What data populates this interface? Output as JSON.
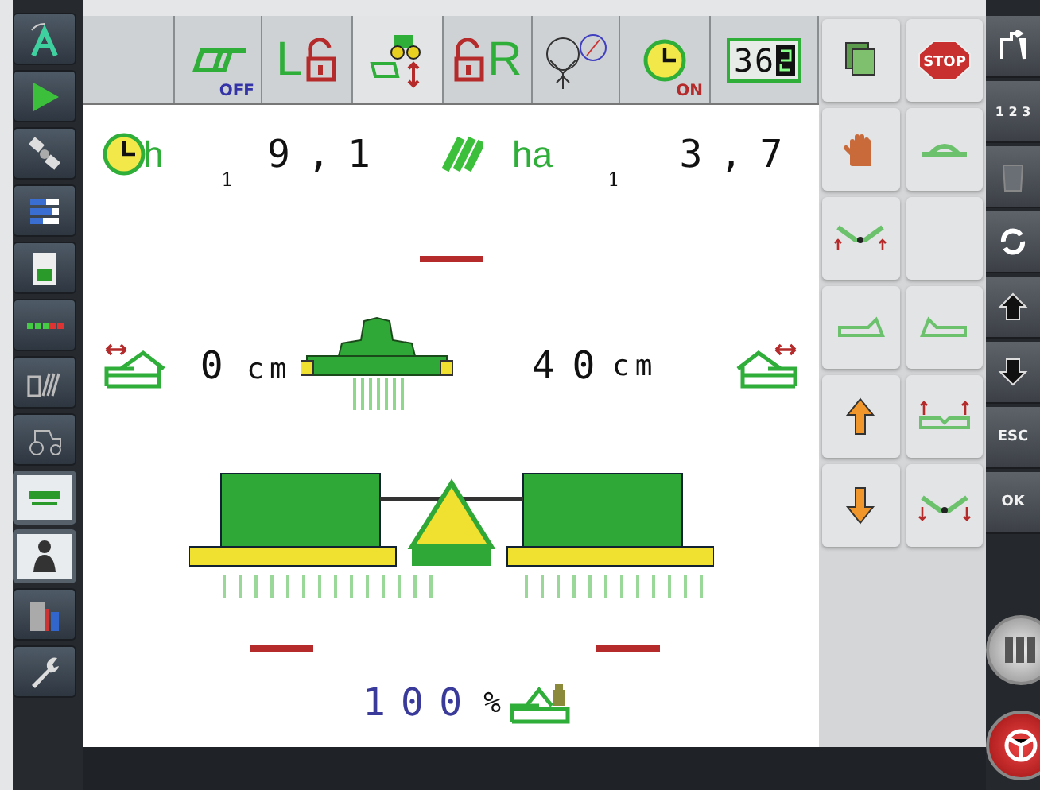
{
  "sidebar": {
    "items": [
      {
        "kind": "navigation"
      },
      {
        "kind": "play"
      },
      {
        "kind": "satellite"
      },
      {
        "kind": "bars"
      },
      {
        "kind": "document"
      },
      {
        "kind": "sections"
      },
      {
        "kind": "area"
      },
      {
        "kind": "tractor"
      },
      {
        "kind": "implement"
      },
      {
        "kind": "operator"
      },
      {
        "kind": "bins"
      },
      {
        "kind": "wrench"
      }
    ]
  },
  "toolbar": {
    "cells": [
      {
        "kind": "blank"
      },
      {
        "kind": "section_control",
        "status": "OFF"
      },
      {
        "kind": "lock_left",
        "label": "L"
      },
      {
        "kind": "tractor"
      },
      {
        "kind": "lock_right",
        "label": "R"
      },
      {
        "kind": "gauge"
      },
      {
        "kind": "timer",
        "status": "ON"
      },
      {
        "kind": "counter",
        "value": "36"
      }
    ]
  },
  "counters": [
    {
      "kind": "time",
      "unit": "h",
      "index": "1",
      "value": "9,1"
    },
    {
      "kind": "area",
      "unit": "ha",
      "index": "1",
      "value": "3,7"
    }
  ],
  "offsets": {
    "left": {
      "value": "0",
      "unit": "cm"
    },
    "right": {
      "value": "40",
      "unit": "cm"
    }
  },
  "rate": {
    "value": "100",
    "unit": "%"
  },
  "softkeys": [
    {
      "kind": "copy"
    },
    {
      "kind": "stop",
      "label": "STOP"
    },
    {
      "kind": "hand"
    },
    {
      "kind": "lift"
    },
    {
      "kind": "fold"
    },
    {
      "kind": "blank"
    },
    {
      "kind": "shift_left"
    },
    {
      "kind": "shift_right"
    },
    {
      "kind": "arrow_up"
    },
    {
      "kind": "raise_sides"
    },
    {
      "kind": "arrow_down"
    },
    {
      "kind": "lower_sides"
    }
  ],
  "side_keys": [
    {
      "kind": "home"
    },
    {
      "kind": "sections",
      "label": "1 2 3"
    },
    {
      "kind": "trash"
    },
    {
      "kind": "refresh"
    },
    {
      "kind": "up"
    },
    {
      "kind": "down"
    },
    {
      "kind": "text",
      "label": "ESC"
    },
    {
      "kind": "text",
      "label": "OK"
    }
  ]
}
